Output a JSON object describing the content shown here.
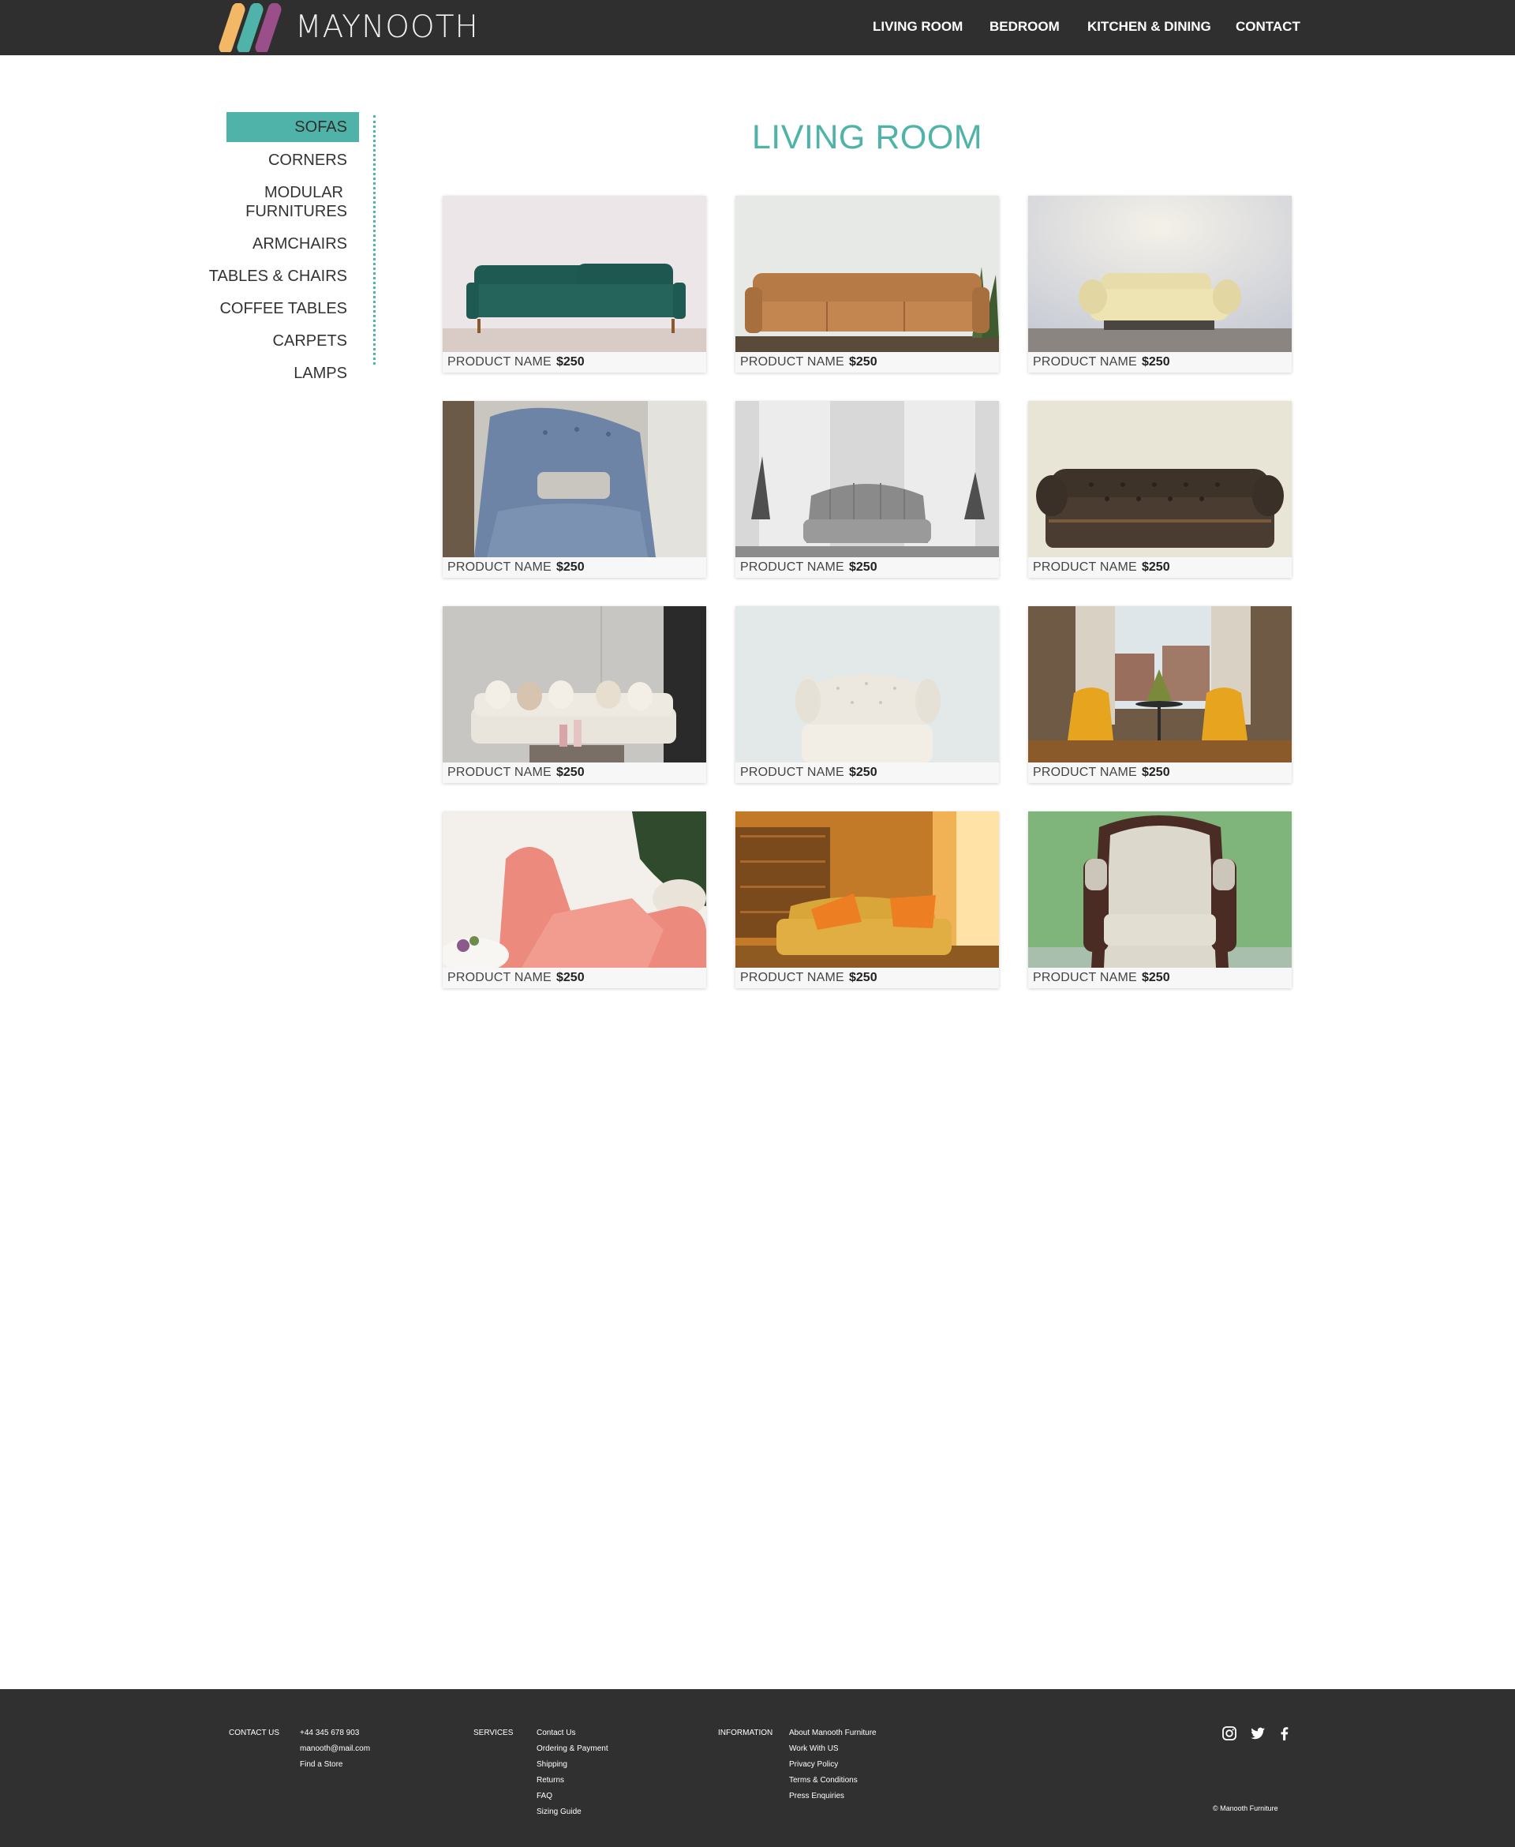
{
  "header": {
    "brand": "MAYNOOTH",
    "nav": [
      "LIVING ROOM",
      "BEDROOM",
      "KITCHEN & DINING",
      "CONTACT"
    ],
    "logo_colors": [
      "#f2b866",
      "#4fb3a9",
      "#9b4f8a"
    ]
  },
  "sidebar": {
    "items": [
      "SOFAS",
      "CORNERS",
      "MODULAR",
      "FURNITURES",
      "ARMCHAIRS",
      "TABLES & CHAIRS",
      "COFFEE TABLES",
      "CARPETS",
      "LAMPS"
    ],
    "active": "SOFAS",
    "accent": "#4fb3a9"
  },
  "main": {
    "title": "LIVING ROOM",
    "products": [
      {
        "name": "PRODUCT NAME",
        "price": "$250",
        "image": "teal velvet sofa"
      },
      {
        "name": "PRODUCT NAME",
        "price": "$250",
        "image": "brown leather sofa"
      },
      {
        "name": "PRODUCT NAME",
        "price": "$250",
        "image": "cream leather sofa"
      },
      {
        "name": "PRODUCT NAME",
        "price": "$250",
        "image": "blue armchair close-up"
      },
      {
        "name": "PRODUCT NAME",
        "price": "$250",
        "image": "grey channel-tufted sofa"
      },
      {
        "name": "PRODUCT NAME",
        "price": "$250",
        "image": "dark chesterfield sofa"
      },
      {
        "name": "PRODUCT NAME",
        "price": "$250",
        "image": "white sofa with cushions"
      },
      {
        "name": "PRODUCT NAME",
        "price": "$250",
        "image": "white tufted armchair"
      },
      {
        "name": "PRODUCT NAME",
        "price": "$250",
        "image": "two yellow chairs by window"
      },
      {
        "name": "PRODUCT NAME",
        "price": "$250",
        "image": "pink velvet lounge chair"
      },
      {
        "name": "PRODUCT NAME",
        "price": "$250",
        "image": "mustard loveseat with orange cushions"
      },
      {
        "name": "PRODUCT NAME",
        "price": "$250",
        "image": "damask armchair on green wall"
      }
    ]
  },
  "footer": {
    "contact_heading": "CONTACT US",
    "contact": [
      "+44 345 678 903",
      "manooth@mail.com",
      "Find a Store"
    ],
    "services_heading": "SERVICES",
    "services": [
      "Contact Us",
      "Ordering & Payment",
      "Shipping",
      "Returns",
      "FAQ",
      "Sizing Guide"
    ],
    "information_heading": "INFORMATION",
    "information": [
      "About Manooth Furniture",
      "Work With US",
      "Privacy Policy",
      "Terms & Conditions",
      "Press Enquiries"
    ],
    "social": [
      "instagram-icon",
      "twitter-icon",
      "facebook-icon"
    ],
    "copyright": "© Manooth Furniture"
  }
}
